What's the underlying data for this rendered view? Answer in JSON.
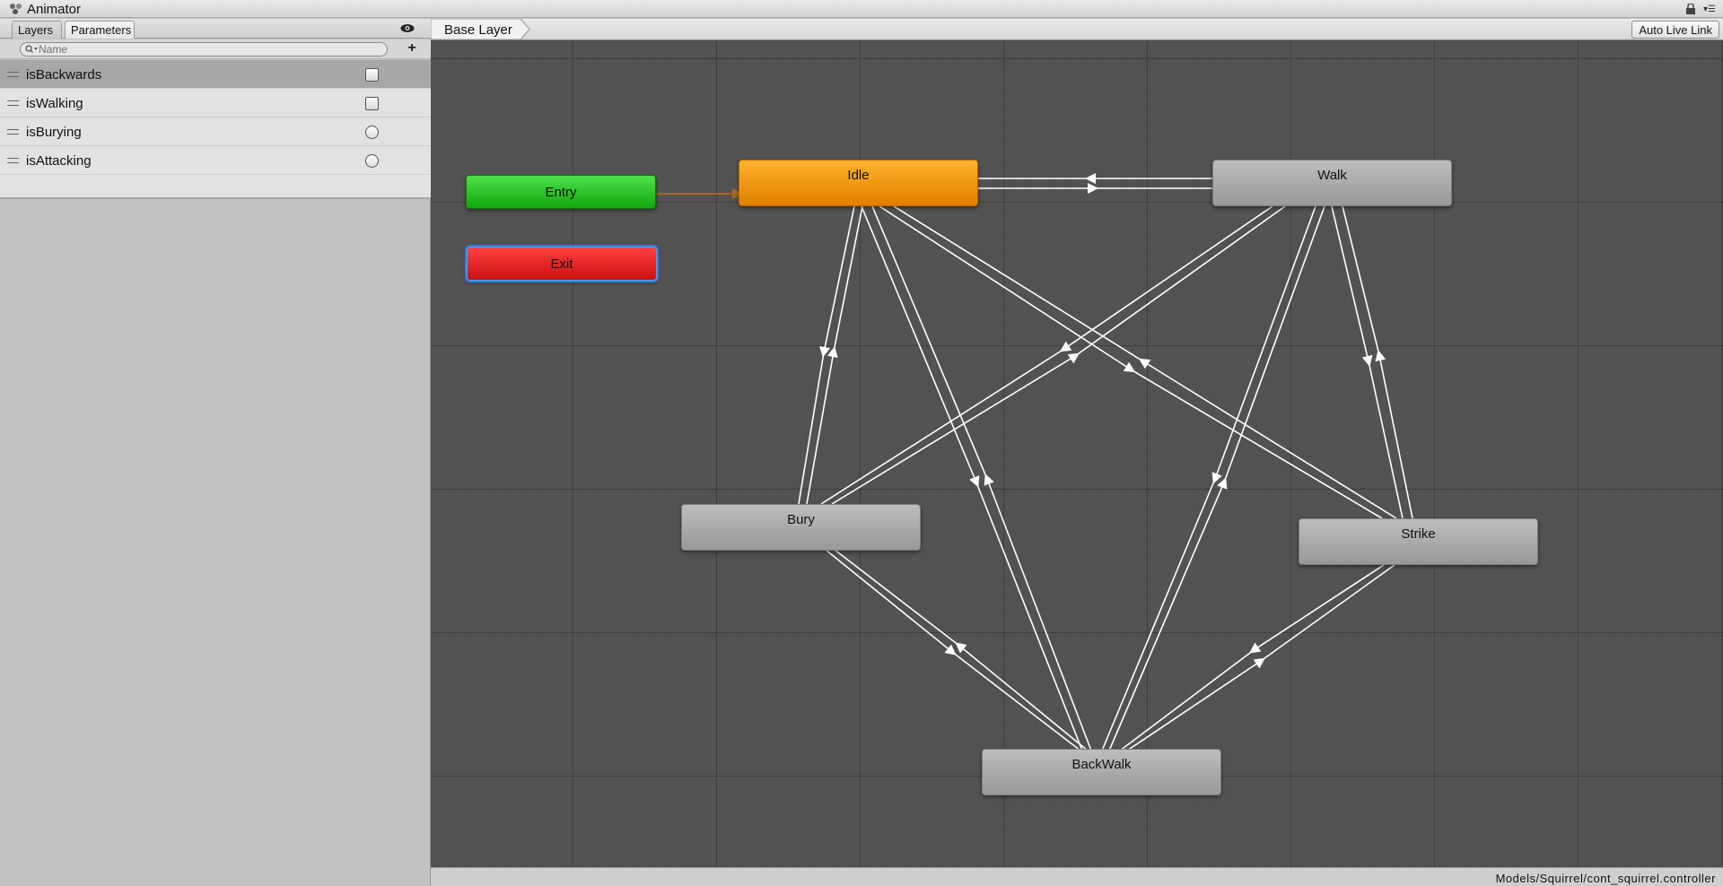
{
  "window": {
    "title": "Animator"
  },
  "tabs": {
    "layers": "Layers",
    "parameters": "Parameters"
  },
  "search": {
    "placeholder": "Name",
    "value": ""
  },
  "parameters": [
    {
      "name": "isBackwards",
      "type": "bool",
      "selected": true
    },
    {
      "name": "isWalking",
      "type": "bool",
      "selected": false
    },
    {
      "name": "isBurying",
      "type": "trigger",
      "selected": false
    },
    {
      "name": "isAttacking",
      "type": "trigger",
      "selected": false
    }
  ],
  "graph": {
    "breadcrumb": "Base Layer",
    "auto_live_link": "Auto Live Link",
    "states": {
      "entry": "Entry",
      "exit": "Exit",
      "idle": "Idle",
      "walk": "Walk",
      "bury": "Bury",
      "strike": "Strike",
      "backwalk": "BackWalk"
    }
  },
  "status": {
    "asset_path": "Models/Squirrel/cont_squirrel.controller"
  },
  "colors": {
    "default_state": "#e08a00",
    "entry_state": "#1fb81a",
    "exit_state": "#e01f1f",
    "graph_background": "#525252",
    "transition": "#ffffff",
    "entry_transition": "#a86a1a"
  }
}
